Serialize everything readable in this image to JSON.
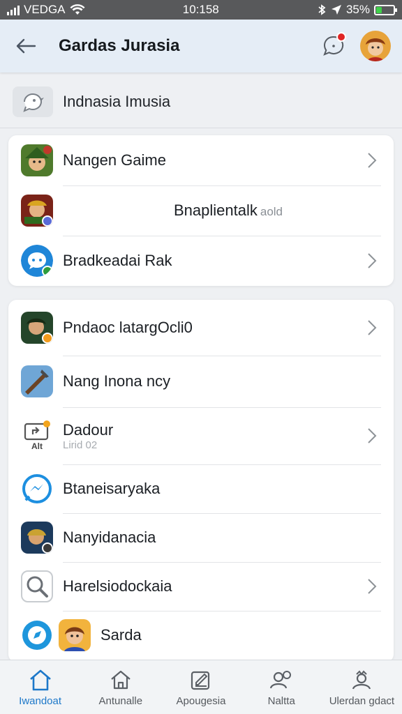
{
  "status": {
    "carrier": "VEDGA",
    "time": "10:158",
    "battery": "35%",
    "battery_level": 0.35
  },
  "header": {
    "title": "Gardas Jurasia"
  },
  "subheader": {
    "title": "Indnasia Imusia"
  },
  "card1": {
    "items": [
      {
        "label": "Nangen Gaime",
        "note": ""
      },
      {
        "label": "Bnaplientalk",
        "note": "aold"
      },
      {
        "label": "Bradkeadai Rak",
        "note": ""
      }
    ]
  },
  "card2": {
    "items": [
      {
        "label": "Pndaoc latargOcli0",
        "sub": "",
        "icon_text": ""
      },
      {
        "label": "Nang Inona ncy",
        "sub": "",
        "icon_text": ""
      },
      {
        "label": "Dadour",
        "sub": "Lirid 02",
        "icon_text": "Alt"
      },
      {
        "label": "Btaneisaryaka",
        "sub": "",
        "icon_text": ""
      },
      {
        "label": "Nanyidanacia",
        "sub": "",
        "icon_text": ""
      },
      {
        "label": "Harelsiodockaia",
        "sub": "",
        "icon_text": ""
      },
      {
        "label": "Sarda",
        "sub": "",
        "icon_text": ""
      }
    ]
  },
  "bottom_nav": [
    {
      "label": "Iwandoat",
      "icon": "home-icon",
      "active": true
    },
    {
      "label": "Antunalle",
      "icon": "house-icon",
      "active": false
    },
    {
      "label": "Apougesia",
      "icon": "edit-icon",
      "active": false
    },
    {
      "label": "Naltta",
      "icon": "contacts-icon",
      "active": false
    },
    {
      "label": "Ulerdan gdact",
      "icon": "profile-icon",
      "active": false
    }
  ],
  "colors": {
    "accent": "#1d78c9",
    "status_bar": "#58595b",
    "header_bg": "#e5edf6",
    "badge": "#e02525",
    "battery": "#3fd04a"
  }
}
